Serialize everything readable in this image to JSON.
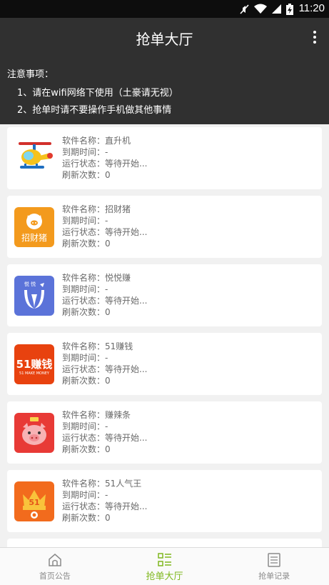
{
  "status_bar": {
    "time": "11:20",
    "icons": [
      "mute-icon",
      "wifi-icon",
      "signal-icon",
      "battery-icon"
    ]
  },
  "app_bar": {
    "title": "抢单大厅"
  },
  "notice": {
    "title": "注意事项：",
    "line1": "1、请在wifi网络下使用（土豪请无视）",
    "line2": "2、抢单时请不要操作手机做其他事情"
  },
  "cards": [
    {
      "name_line": "软件名称：直升机",
      "expiry_line": "到期时间：-",
      "status_line": "运行状态：等待开始...",
      "refresh_line": "刷新次数：0",
      "icon": "helicopter-app-icon"
    },
    {
      "name_line": "软件名称：招财猪",
      "expiry_line": "到期时间：-",
      "status_line": "运行状态：等待开始...",
      "refresh_line": "刷新次数：0",
      "icon": "zhaocaizhu-app-icon",
      "icon_text": "招财猪"
    },
    {
      "name_line": "软件名称：悦悦赚",
      "expiry_line": "到期时间：-",
      "status_line": "运行状态：等待开始...",
      "refresh_line": "刷新次数：0",
      "icon": "yueyuezhuan-app-icon",
      "icon_text": "悦 悦"
    },
    {
      "name_line": "软件名称：51赚钱",
      "expiry_line": "到期时间：-",
      "status_line": "运行状态：等待开始...",
      "refresh_line": "刷新次数：0",
      "icon": "51-zhuanqian-app-icon",
      "icon_text": "51赚钱",
      "icon_subtext": "51 MAKE MONEY"
    },
    {
      "name_line": "软件名称：赚辣条",
      "expiry_line": "到期时间：-",
      "status_line": "运行状态：等待开始...",
      "refresh_line": "刷新次数：0",
      "icon": "zhuanlatiao-app-icon"
    },
    {
      "name_line": "软件名称：51人气王",
      "expiry_line": "到期时间：-",
      "status_line": "运行状态：等待开始...",
      "refresh_line": "刷新次数：0",
      "icon": "51-renqiwang-app-icon",
      "icon_text": "51"
    }
  ],
  "bottom_nav": {
    "items": [
      {
        "label": "首页公告",
        "icon": "home-icon",
        "active": false
      },
      {
        "label": "抢单大厅",
        "icon": "list-icon",
        "active": true
      },
      {
        "label": "抢单记录",
        "icon": "document-icon",
        "active": false
      }
    ]
  },
  "colors": {
    "header_bg": "#303030",
    "accent": "#7fb81e",
    "page_bg": "#f1f1f1"
  }
}
